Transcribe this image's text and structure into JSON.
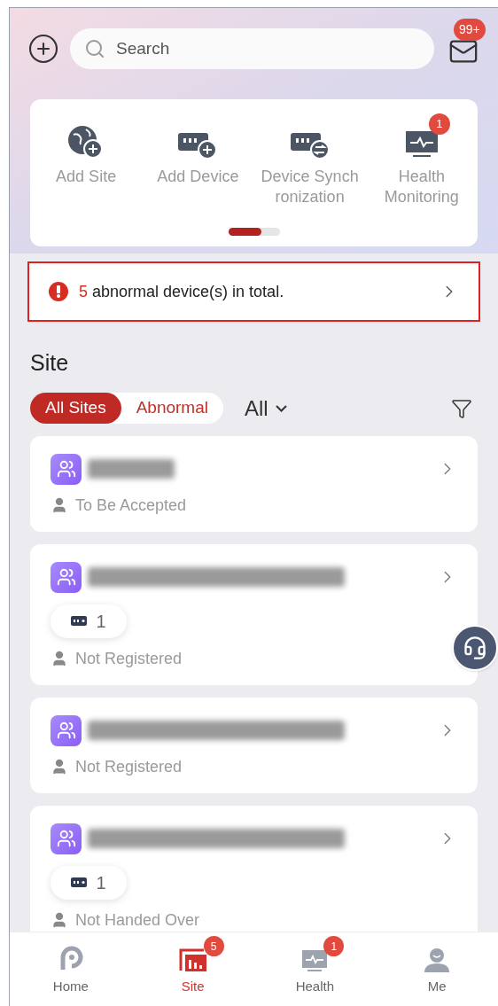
{
  "header": {
    "search": {
      "placeholder": "Search"
    },
    "mail_badge": "99+"
  },
  "quick_actions": [
    {
      "kind": "site",
      "label": "Add Site"
    },
    {
      "kind": "device",
      "label": "Add Device"
    },
    {
      "kind": "sync",
      "label": "Device Synch ronization"
    },
    {
      "kind": "health",
      "label": "Health Monitoring",
      "badge": "1"
    }
  ],
  "pager": {
    "level": 0.65
  },
  "alert": {
    "count": "5",
    "text": "abnormal device(s) in total."
  },
  "site": {
    "title": "Site",
    "segments": [
      {
        "label": "All Sites",
        "selected": true
      },
      {
        "label": "Abnormal",
        "selected": false
      }
    ],
    "dropdown": "All",
    "cards": [
      {
        "status": "To Be Accepted"
      },
      {
        "device_count": "1",
        "status": "Not Registered"
      },
      {
        "status": "Not Registered"
      },
      {
        "device_count": "1",
        "status": "Not Handed Over"
      }
    ]
  },
  "tabs": [
    {
      "kind": "home",
      "label": "Home",
      "selected": false
    },
    {
      "kind": "site",
      "label": "Site",
      "selected": true,
      "badge": "5"
    },
    {
      "kind": "health",
      "label": "Health",
      "selected": false,
      "badge": "1"
    },
    {
      "kind": "me",
      "label": "Me",
      "selected": false
    }
  ]
}
